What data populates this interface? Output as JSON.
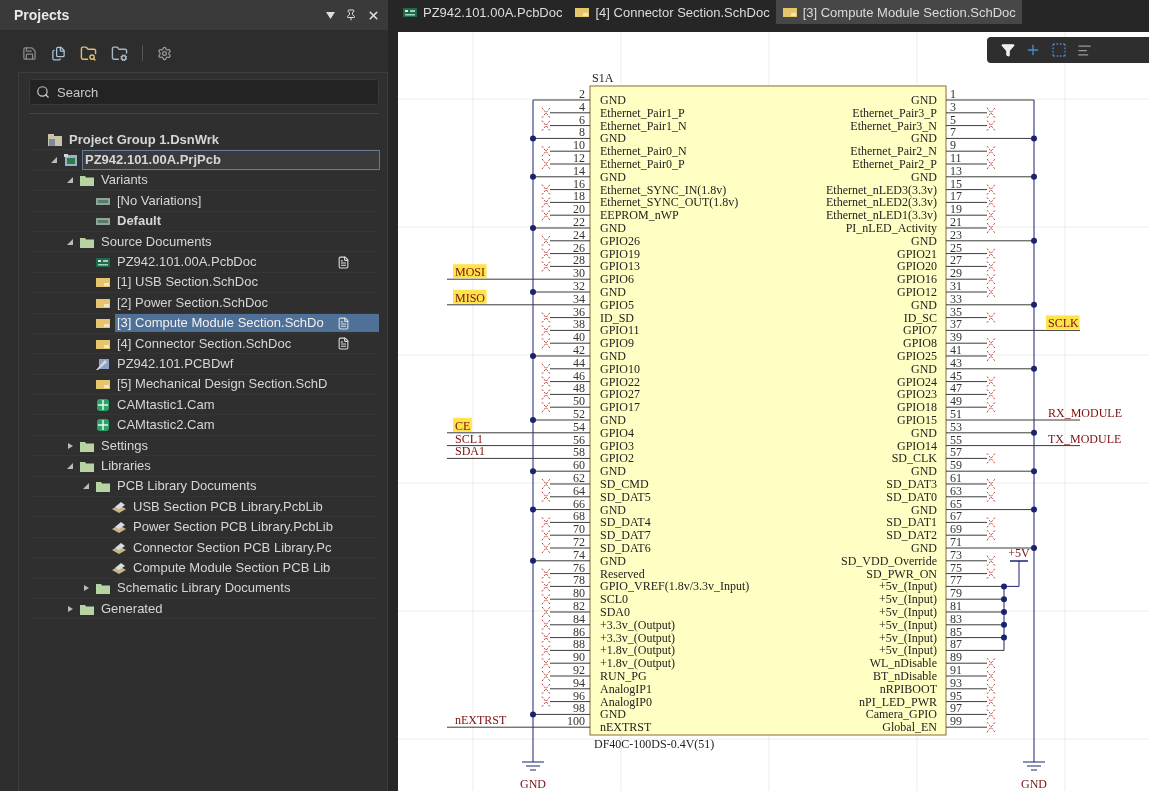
{
  "panel": {
    "title": "Projects",
    "search": {
      "placeholder": "Search"
    },
    "tree": [
      {
        "label": "Project Group 1.DsnWrk",
        "kind": "group",
        "bold": true,
        "selected": false,
        "children": [
          {
            "label": "PZ942.101.00A.PrjPcb",
            "kind": "project",
            "bold": true,
            "focused": true,
            "selected": false,
            "expanded": true,
            "children": [
              {
                "label": "Variants",
                "kind": "folder",
                "selected": false,
                "expanded": true,
                "children": [
                  {
                    "label": "[No Variations]",
                    "kind": "variant",
                    "selected": false
                  },
                  {
                    "label": "Default",
                    "kind": "variant",
                    "bold": true,
                    "selected": false
                  }
                ]
              },
              {
                "label": "Source Documents",
                "kind": "folder",
                "selected": false,
                "expanded": true,
                "children": [
                  {
                    "label": "PZ942.101.00A.PcbDoc",
                    "kind": "pcb",
                    "flag": true,
                    "selected": false
                  },
                  {
                    "label": "[1] USB Section.SchDoc",
                    "kind": "sch",
                    "selected": false
                  },
                  {
                    "label": "[2] Power Section.SchDoc",
                    "kind": "sch",
                    "selected": false
                  },
                  {
                    "label": "[3] Compute Module Section.SchDo",
                    "kind": "sch",
                    "flag": true,
                    "selected": true
                  },
                  {
                    "label": "[4] Connector Section.SchDoc",
                    "kind": "sch",
                    "flag": true,
                    "selected": false
                  },
                  {
                    "label": "PZ942.101.PCBDwf",
                    "kind": "pcbdwf",
                    "selected": false
                  },
                  {
                    "label": "[5] Mechanical Design Section.SchD",
                    "kind": "sch",
                    "selected": false
                  },
                  {
                    "label": "CAMtastic1.Cam",
                    "kind": "cam",
                    "selected": false
                  },
                  {
                    "label": "CAMtastic2.Cam",
                    "kind": "cam",
                    "selected": false
                  }
                ]
              },
              {
                "label": "Settings",
                "kind": "folder",
                "selected": false,
                "expanded": false
              },
              {
                "label": "Libraries",
                "kind": "folder",
                "selected": false,
                "expanded": true,
                "children": [
                  {
                    "label": "PCB Library Documents",
                    "kind": "folder",
                    "selected": false,
                    "expanded": true,
                    "children": [
                      {
                        "label": "USB Section PCB Library.PcbLib",
                        "kind": "pcblib",
                        "selected": false
                      },
                      {
                        "label": "Power Section PCB Library.PcbLib",
                        "kind": "pcblib",
                        "selected": false
                      },
                      {
                        "label": "Connector Section PCB Library.Pc",
                        "kind": "pcblib",
                        "selected": false
                      },
                      {
                        "label": "Compute Module Section PCB Lib",
                        "kind": "pcblib",
                        "selected": false
                      }
                    ]
                  },
                  {
                    "label": "Schematic Library Documents",
                    "kind": "folder",
                    "selected": false,
                    "expanded": false
                  }
                ]
              },
              {
                "label": "Generated",
                "kind": "folder",
                "selected": false,
                "expanded": false
              }
            ]
          }
        ]
      }
    ]
  },
  "tabs": [
    {
      "label": "PZ942.101.00A.PcbDoc",
      "kind": "pcb",
      "selected": false
    },
    {
      "label": "[4] Connector Section.SchDoc",
      "kind": "sch",
      "selected": false
    },
    {
      "label": "[3] Compute Module Section.SchDoc",
      "kind": "sch",
      "selected": true
    }
  ],
  "schematic": {
    "designator": "S1A",
    "part": "DF40C-100DS-0.4V(51)",
    "left_ground": {
      "label": "GND"
    },
    "right_ground": {
      "label": "GND"
    },
    "power_symbol": {
      "label": "+5V"
    },
    "left_pins": [
      {
        "number": "2",
        "name": "GND",
        "kind": "gnd"
      },
      {
        "number": "4",
        "name": "Ethernet_Pair1_P",
        "kind": "nc"
      },
      {
        "number": "6",
        "name": "Ethernet_Pair1_N",
        "kind": "nc"
      },
      {
        "number": "8",
        "name": "GND",
        "kind": "gnd"
      },
      {
        "number": "10",
        "name": "Ethernet_Pair0_N",
        "kind": "nc"
      },
      {
        "number": "12",
        "name": "Ethernet_Pair0_P",
        "kind": "nc"
      },
      {
        "number": "14",
        "name": "GND",
        "kind": "gnd"
      },
      {
        "number": "16",
        "name": "Ethernet_SYNC_IN(1.8v)",
        "kind": "nc"
      },
      {
        "number": "18",
        "name": "Ethernet_SYNC_OUT(1.8v)",
        "kind": "nc"
      },
      {
        "number": "20",
        "name": "EEPROM_nWP",
        "kind": "nc"
      },
      {
        "number": "22",
        "name": "GND",
        "kind": "gnd"
      },
      {
        "number": "24",
        "name": "GPIO26",
        "kind": "nc"
      },
      {
        "number": "26",
        "name": "GPIO19",
        "kind": "nc"
      },
      {
        "number": "28",
        "name": "GPIO13",
        "kind": "nc"
      },
      {
        "number": "30",
        "name": "GPIO6",
        "kind": "net",
        "net": {
          "text": "MOSI",
          "highlighted": true
        }
      },
      {
        "number": "32",
        "name": "GND",
        "kind": "gnd"
      },
      {
        "number": "34",
        "name": "GPIO5",
        "kind": "net",
        "net": {
          "text": "MISO",
          "highlighted": true
        }
      },
      {
        "number": "36",
        "name": "ID_SD",
        "kind": "nc"
      },
      {
        "number": "38",
        "name": "GPIO11",
        "kind": "nc"
      },
      {
        "number": "40",
        "name": "GPIO9",
        "kind": "nc"
      },
      {
        "number": "42",
        "name": "GND",
        "kind": "gnd"
      },
      {
        "number": "44",
        "name": "GPIO10",
        "kind": "nc"
      },
      {
        "number": "46",
        "name": "GPIO22",
        "kind": "nc"
      },
      {
        "number": "48",
        "name": "GPIO27",
        "kind": "nc"
      },
      {
        "number": "50",
        "name": "GPIO17",
        "kind": "nc"
      },
      {
        "number": "52",
        "name": "GND",
        "kind": "gnd"
      },
      {
        "number": "54",
        "name": "GPIO4",
        "kind": "net",
        "net": {
          "text": "CE",
          "highlighted": true
        }
      },
      {
        "number": "56",
        "name": "GPIO3",
        "kind": "net",
        "net": {
          "text": "SCL1",
          "highlighted": false
        }
      },
      {
        "number": "58",
        "name": "GPIO2",
        "kind": "net",
        "net": {
          "text": "SDA1",
          "highlighted": false
        }
      },
      {
        "number": "60",
        "name": "GND",
        "kind": "gnd"
      },
      {
        "number": "62",
        "name": "SD_CMD",
        "kind": "nc"
      },
      {
        "number": "64",
        "name": "SD_DAT5",
        "kind": "nc"
      },
      {
        "number": "66",
        "name": "GND",
        "kind": "gnd"
      },
      {
        "number": "68",
        "name": "SD_DAT4",
        "kind": "nc"
      },
      {
        "number": "70",
        "name": "SD_DAT7",
        "kind": "nc"
      },
      {
        "number": "72",
        "name": "SD_DAT6",
        "kind": "nc"
      },
      {
        "number": "74",
        "name": "GND",
        "kind": "gnd"
      },
      {
        "number": "76",
        "name": "Reserved",
        "kind": "nc"
      },
      {
        "number": "78",
        "name": "GPIO_VREF(1.8v/3.3v_Input)",
        "kind": "nc"
      },
      {
        "number": "80",
        "name": "SCL0",
        "kind": "nc"
      },
      {
        "number": "82",
        "name": "SDA0",
        "kind": "nc"
      },
      {
        "number": "84",
        "name": "+3.3v_(Output)",
        "kind": "nc"
      },
      {
        "number": "86",
        "name": "+3.3v_(Output)",
        "kind": "nc"
      },
      {
        "number": "88",
        "name": "+1.8v_(Output)",
        "kind": "nc"
      },
      {
        "number": "90",
        "name": "+1.8v_(Output)",
        "kind": "nc"
      },
      {
        "number": "92",
        "name": "RUN_PG",
        "kind": "nc"
      },
      {
        "number": "94",
        "name": "AnalogIP1",
        "kind": "nc"
      },
      {
        "number": "96",
        "name": "AnalogIP0",
        "kind": "nc"
      },
      {
        "number": "98",
        "name": "GND",
        "kind": "gnd"
      },
      {
        "number": "100",
        "name": "nEXTRST",
        "kind": "net",
        "net": {
          "text": "nEXTRST",
          "highlighted": false
        }
      }
    ],
    "right_pins": [
      {
        "number": "1",
        "name": "GND",
        "kind": "gnd"
      },
      {
        "number": "3",
        "name": "Ethernet_Pair3_P",
        "kind": "nc"
      },
      {
        "number": "5",
        "name": "Ethernet_Pair3_N",
        "kind": "nc"
      },
      {
        "number": "7",
        "name": "GND",
        "kind": "gnd"
      },
      {
        "number": "9",
        "name": "Ethernet_Pair2_N",
        "kind": "nc"
      },
      {
        "number": "11",
        "name": "Ethernet_Pair2_P",
        "kind": "nc"
      },
      {
        "number": "13",
        "name": "GND",
        "kind": "gnd"
      },
      {
        "number": "15",
        "name": "Ethernet_nLED3(3.3v)",
        "kind": "nc"
      },
      {
        "number": "17",
        "name": "Ethernet_nLED2(3.3v)",
        "kind": "nc"
      },
      {
        "number": "19",
        "name": "Ethernet_nLED1(3.3v)",
        "kind": "nc"
      },
      {
        "number": "21",
        "name": "PI_nLED_Activity",
        "kind": "nc"
      },
      {
        "number": "23",
        "name": "GND",
        "kind": "gnd"
      },
      {
        "number": "25",
        "name": "GPIO21",
        "kind": "nc"
      },
      {
        "number": "27",
        "name": "GPIO20",
        "kind": "nc"
      },
      {
        "number": "29",
        "name": "GPIO16",
        "kind": "nc"
      },
      {
        "number": "31",
        "name": "GPIO12",
        "kind": "nc"
      },
      {
        "number": "33",
        "name": "GND",
        "kind": "gnd"
      },
      {
        "number": "35",
        "name": "ID_SC",
        "kind": "nc"
      },
      {
        "number": "37",
        "name": "GPIO7",
        "kind": "net",
        "net": {
          "text": "SCLK",
          "highlighted": true
        }
      },
      {
        "number": "39",
        "name": "GPIO8",
        "kind": "nc"
      },
      {
        "number": "41",
        "name": "GPIO25",
        "kind": "nc"
      },
      {
        "number": "43",
        "name": "GND",
        "kind": "gnd"
      },
      {
        "number": "45",
        "name": "GPIO24",
        "kind": "nc"
      },
      {
        "number": "47",
        "name": "GPIO23",
        "kind": "nc"
      },
      {
        "number": "49",
        "name": "GPIO18",
        "kind": "nc"
      },
      {
        "number": "51",
        "name": "GPIO15",
        "kind": "net",
        "net": {
          "text": "RX_MODULE",
          "highlighted": false
        }
      },
      {
        "number": "53",
        "name": "GND",
        "kind": "gnd"
      },
      {
        "number": "55",
        "name": "GPIO14",
        "kind": "net",
        "net": {
          "text": "TX_MODULE",
          "highlighted": false
        }
      },
      {
        "number": "57",
        "name": "SD_CLK",
        "kind": "nc"
      },
      {
        "number": "59",
        "name": "GND",
        "kind": "gnd"
      },
      {
        "number": "61",
        "name": "SD_DAT3",
        "kind": "nc"
      },
      {
        "number": "63",
        "name": "SD_DAT0",
        "kind": "nc"
      },
      {
        "number": "65",
        "name": "GND",
        "kind": "gnd"
      },
      {
        "number": "67",
        "name": "SD_DAT1",
        "kind": "nc"
      },
      {
        "number": "69",
        "name": "SD_DAT2",
        "kind": "nc"
      },
      {
        "number": "71",
        "name": "GND",
        "kind": "gnd"
      },
      {
        "number": "73",
        "name": "SD_VDD_Override",
        "kind": "nc"
      },
      {
        "number": "75",
        "name": "SD_PWR_ON",
        "kind": "nc"
      },
      {
        "number": "77",
        "name": "+5v_(Input)",
        "kind": "power"
      },
      {
        "number": "79",
        "name": "+5v_(Input)",
        "kind": "power"
      },
      {
        "number": "81",
        "name": "+5v_(Input)",
        "kind": "power"
      },
      {
        "number": "83",
        "name": "+5v_(Input)",
        "kind": "power"
      },
      {
        "number": "85",
        "name": "+5v_(Input)",
        "kind": "power"
      },
      {
        "number": "87",
        "name": "+5v_(Input)",
        "kind": "power"
      },
      {
        "number": "89",
        "name": "WL_nDisable",
        "kind": "nc"
      },
      {
        "number": "91",
        "name": "BT_nDisable",
        "kind": "nc"
      },
      {
        "number": "93",
        "name": "nRPIBOOT",
        "kind": "nc"
      },
      {
        "number": "95",
        "name": "nPI_LED_PWR",
        "kind": "nc"
      },
      {
        "number": "97",
        "name": "Camera_GPIO",
        "kind": "nc"
      },
      {
        "number": "99",
        "name": "Global_EN",
        "kind": "nc"
      }
    ]
  }
}
